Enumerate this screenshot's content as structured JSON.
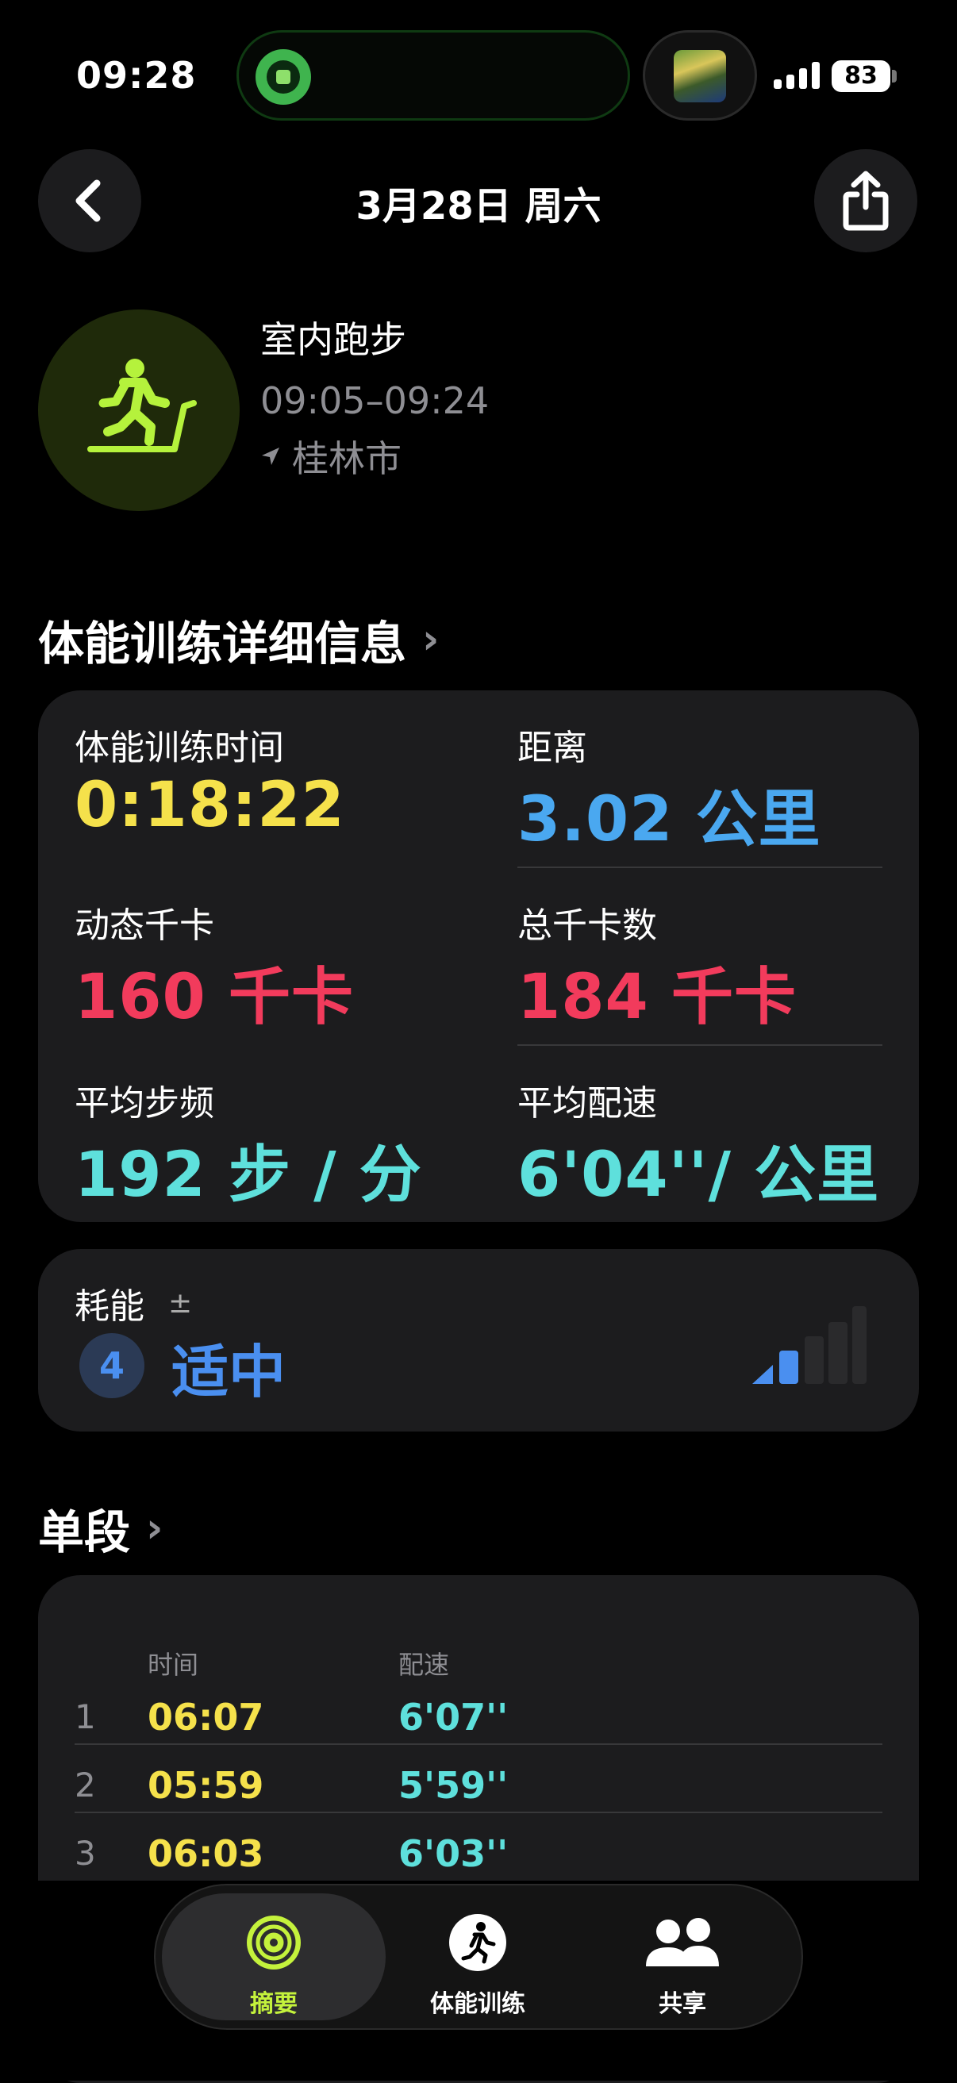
{
  "status_bar": {
    "time": "09:28",
    "battery": "83"
  },
  "nav": {
    "title": "3月28日 周六"
  },
  "workout": {
    "name": "室内跑步",
    "time_range": "09:05–09:24",
    "location": "桂林市"
  },
  "details": {
    "header": "体能训练详细信息",
    "stats": [
      {
        "label": "体能训练时间",
        "value": "0:18:22",
        "color": "#f5e14b"
      },
      {
        "label": "距离",
        "value": "3.02 公里",
        "color": "#4aa8f0"
      },
      {
        "label": "动态千卡",
        "value": "160 千卡",
        "color": "#f23b5c"
      },
      {
        "label": "总千卡数",
        "value": "184 千卡",
        "color": "#f23b5c"
      },
      {
        "label": "平均步频",
        "value": "192 步 / 分",
        "color": "#5ee0dc"
      },
      {
        "label": "平均配速",
        "value": "6'04''/ 公里",
        "color": "#5ee0dc"
      }
    ]
  },
  "effort": {
    "label": "耗能",
    "plus_minus": "±",
    "level": "4",
    "level_text": "适中",
    "level_fraction": 0.4,
    "accent": "#4a8ff0"
  },
  "splits": {
    "header": "单段",
    "col_time": "时间",
    "col_pace": "配速",
    "rows": [
      {
        "index": "1",
        "time": "06:07",
        "pace": "6'07''"
      },
      {
        "index": "2",
        "time": "05:59",
        "pace": "5'59''"
      },
      {
        "index": "3",
        "time": "06:03",
        "pace": "6'03''"
      }
    ]
  },
  "tabs": [
    {
      "label": "摘要",
      "icon": "activity-rings-icon",
      "active": true
    },
    {
      "label": "体能训练",
      "icon": "running-figure-icon",
      "active": false
    },
    {
      "label": "共享",
      "icon": "people-icon",
      "active": false
    }
  ]
}
